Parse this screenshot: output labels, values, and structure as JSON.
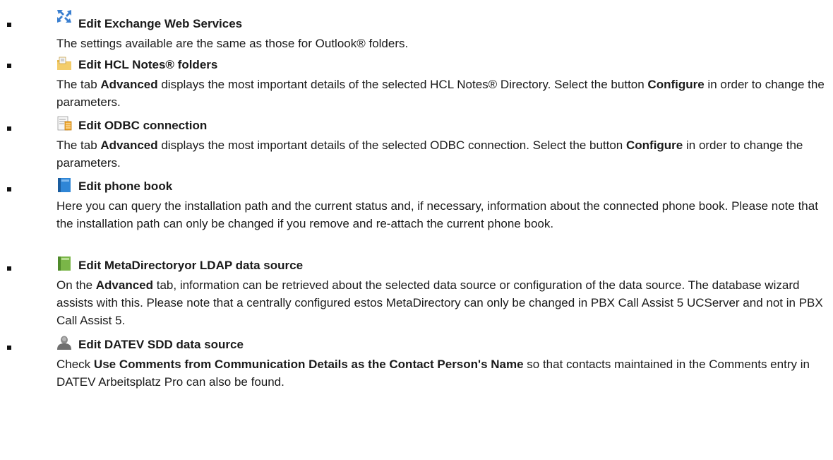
{
  "items": [
    {
      "icon": "exchange-icon",
      "title": "Edit Exchange Web Services",
      "desc": [
        {
          "t": "The settings available are the same as those for Outlook® folders."
        }
      ]
    },
    {
      "icon": "notes-folder-icon",
      "title": "Edit HCL Notes® folders",
      "desc": [
        {
          "t": "The tab "
        },
        {
          "b": "Advanced"
        },
        {
          "t": " displays the most important details of the selected HCL Notes® Directory. Select the button "
        },
        {
          "b": "Configure"
        },
        {
          "t": " in order to change the parameters."
        }
      ]
    },
    {
      "icon": "odbc-icon",
      "title": "Edit ODBC connection",
      "desc": [
        {
          "t": "The tab "
        },
        {
          "b": "Advanced"
        },
        {
          "t": " displays the most important details of the selected ODBC connection. Select the button "
        },
        {
          "b": "Configure"
        },
        {
          "t": " in order to change the parameters."
        }
      ]
    },
    {
      "icon": "phone-book-icon",
      "title": "Edit phone book",
      "desc": [
        {
          "t": "Here you can query the installation path and the current status and, if necessary, information about the connected phone book. Please note that the installation path can only be changed if you remove and re-attach the current phone book."
        }
      ]
    },
    {
      "icon": "metadirectory-icon",
      "title": "Edit MetaDirectoryor LDAP data source",
      "desc": [
        {
          "t": "On the "
        },
        {
          "b": "Advanced"
        },
        {
          "t": " tab, information can be retrieved about the selected data source or configuration of the data source. The database wizard assists with this. Please note that a centrally configured estos MetaDirectory can only be changed in PBX Call Assist 5 UCServer and not in PBX Call Assist 5."
        }
      ]
    },
    {
      "icon": "datev-person-icon",
      "title": "Edit DATEV SDD data source",
      "desc": [
        {
          "t": "Check "
        },
        {
          "b": "Use Comments from Communication Details as the Contact Person's Name"
        },
        {
          "t": " so that contacts maintained in the Comments entry in DATEV Arbeitsplatz Pro can also be found."
        }
      ]
    }
  ]
}
